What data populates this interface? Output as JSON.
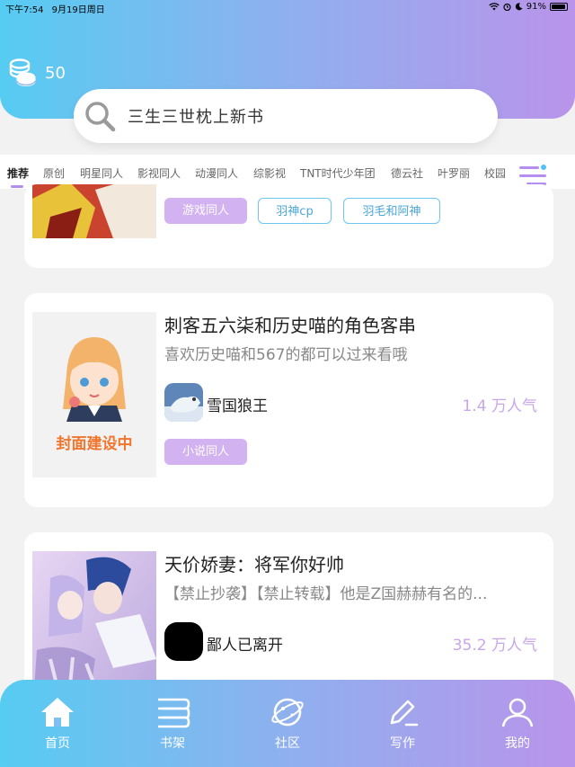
{
  "status_bar": {
    "time": "下午7:54",
    "date": "9月19日周日",
    "battery": "91%"
  },
  "header": {
    "coins": "50"
  },
  "search": {
    "placeholder": "三生三世枕上新书"
  },
  "categories": [
    "推荐",
    "原创",
    "明星同人",
    "影视同人",
    "动漫同人",
    "综影视",
    "TNT时代少年团",
    "德云社",
    "叶罗丽",
    "校园"
  ],
  "cards": [
    {
      "tags": [
        "游戏同人",
        "羽神cp",
        "羽毛和阿神"
      ]
    },
    {
      "title": "刺客五六柒和历史喵的角色客串",
      "desc": "喜欢历史喵和567的都可以过来看哦",
      "cover_text": "封面建设中",
      "author": "雪国狼王",
      "popularity": "1.4 万人气",
      "tags": [
        "小说同人"
      ]
    },
    {
      "title": "天价娇妻：将军你好帅",
      "desc": "【禁止抄袭】【禁止转载】他是Z国赫赫有名的...",
      "author": "鄙人已离开",
      "popularity": "35.2 万人气"
    }
  ],
  "tabbar": {
    "items": [
      "首页",
      "书架",
      "社区",
      "写作",
      "我的"
    ]
  },
  "colors": {
    "gradient_start": "#56ccf2",
    "gradient_end": "#b994ea",
    "accent_purple": "#d3b2f1",
    "accent_blue": "#6dc6ee"
  }
}
